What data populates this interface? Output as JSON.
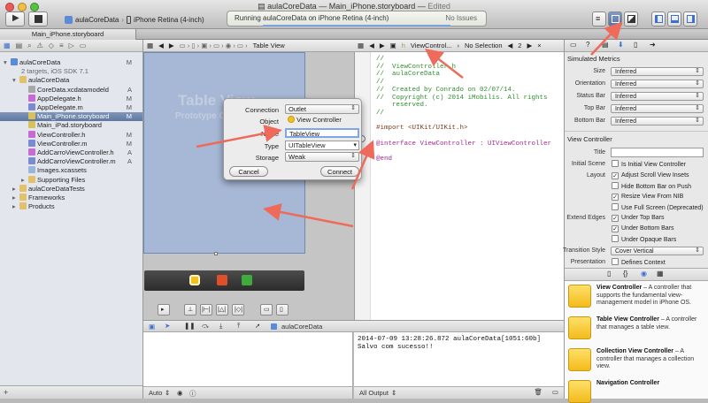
{
  "window": {
    "project_name": "aulaCoreData",
    "file_name": "Main_iPhone.storyboard",
    "edited_label": "Edited",
    "title_separator": "—"
  },
  "toolbar": {
    "scheme_project": "aulaCoreData",
    "scheme_device": "iPhone Retina (4-inch)",
    "status_text": "Running aulaCoreData on iPhone Retina (4-inch)",
    "issues_text": "No Issues"
  },
  "tab": {
    "label": "Main_iPhone.storyboard"
  },
  "navigator": {
    "items": [
      {
        "label": "aulaCoreData",
        "status": "M",
        "indent": 0,
        "kind": "project"
      },
      {
        "label": "2 targets, iOS SDK 7.1",
        "status": "",
        "indent": 1,
        "kind": "sub"
      },
      {
        "label": "aulaCoreData",
        "status": "",
        "indent": 1,
        "kind": "folder"
      },
      {
        "label": "CoreData.xcdatamodeld",
        "status": "A",
        "indent": 2,
        "kind": "model"
      },
      {
        "label": "AppDelegate.h",
        "status": "M",
        "indent": 2,
        "kind": "h"
      },
      {
        "label": "AppDelegate.m",
        "status": "M",
        "indent": 2,
        "kind": "m"
      },
      {
        "label": "Main_iPhone.storyboard",
        "status": "M",
        "indent": 2,
        "kind": "sb",
        "selected": true
      },
      {
        "label": "Main_iPad.storyboard",
        "status": "",
        "indent": 2,
        "kind": "sb"
      },
      {
        "label": "ViewController.h",
        "status": "M",
        "indent": 2,
        "kind": "h"
      },
      {
        "label": "ViewController.m",
        "status": "M",
        "indent": 2,
        "kind": "m"
      },
      {
        "label": "AddCarroViewController.h",
        "status": "A",
        "indent": 2,
        "kind": "h"
      },
      {
        "label": "AddCarroViewController.m",
        "status": "A",
        "indent": 2,
        "kind": "m"
      },
      {
        "label": "Images.xcassets",
        "status": "",
        "indent": 2,
        "kind": "assets"
      },
      {
        "label": "Supporting Files",
        "status": "",
        "indent": 2,
        "kind": "folder"
      },
      {
        "label": "aulaCoreDataTests",
        "status": "",
        "indent": 1,
        "kind": "folder"
      },
      {
        "label": "Frameworks",
        "status": "",
        "indent": 1,
        "kind": "folder"
      },
      {
        "label": "Products",
        "status": "",
        "indent": 1,
        "kind": "folder"
      }
    ]
  },
  "storyboard": {
    "jump_label": "Table View",
    "scene_title": "Table View",
    "scene_subtitle": "Prototype Content"
  },
  "assistant": {
    "jump_file": "ViewControl...",
    "jump_selection": "No Selection",
    "page_indicator": "2",
    "code_lines": [
      {
        "t": "//",
        "c": "cm"
      },
      {
        "t": "//  ViewController.h",
        "c": "cm"
      },
      {
        "t": "//  aulaCoreData",
        "c": "cm"
      },
      {
        "t": "//",
        "c": "cm"
      },
      {
        "t": "//  Created by Conrado on 02/07/14.",
        "c": "cm"
      },
      {
        "t": "//  Copyright (c) 2014 iMobilis. All rights",
        "c": "cm"
      },
      {
        "t": "    reserved.",
        "c": "cm"
      },
      {
        "t": "//",
        "c": "cm"
      },
      {
        "t": "",
        "c": ""
      },
      {
        "t": "#import <UIKit/UIKit.h>",
        "c": "pp"
      },
      {
        "t": "",
        "c": ""
      },
      {
        "t": "@interface ViewController : UIViewController",
        "c": "kw"
      },
      {
        "t": "",
        "c": ""
      },
      {
        "t": "@end",
        "c": "kw"
      }
    ]
  },
  "connection_popup": {
    "connection_label": "Connection",
    "connection_value": "Outlet",
    "object_label": "Object",
    "object_value": "View Controller",
    "name_label": "Name",
    "name_value": "TableView",
    "type_label": "Type",
    "type_value": "UITableView",
    "storage_label": "Storage",
    "storage_value": "Weak",
    "cancel_label": "Cancel",
    "connect_label": "Connect"
  },
  "debug": {
    "target_label": "aulaCoreData",
    "console_text": "2014-07-09 13:28:26.872 aulaCoreData[1051:60b] Salvo com sucesso!!",
    "auto_label": "Auto",
    "all_output_label": "All Output"
  },
  "inspector": {
    "simulated_title": "Simulated Metrics",
    "size_label": "Size",
    "size_value": "Inferred",
    "orientation_label": "Orientation",
    "orientation_value": "Inferred",
    "status_bar_label": "Status Bar",
    "status_bar_value": "Inferred",
    "top_bar_label": "Top Bar",
    "top_bar_value": "Inferred",
    "bottom_bar_label": "Bottom Bar",
    "bottom_bar_value": "Inferred",
    "vc_title": "View Controller",
    "title_label": "Title",
    "initial_scene_label": "Initial Scene",
    "is_initial_label": "Is Initial View Controller",
    "layout_label": "Layout",
    "adjust_scroll_label": "Adjust Scroll View Insets",
    "hide_bottom_label": "Hide Bottom Bar on Push",
    "resize_label": "Resize View From NIB",
    "use_full_label": "Use Full Screen (Deprecated)",
    "extend_edges_label": "Extend Edges",
    "under_top_label": "Under Top Bars",
    "under_bottom_label": "Under Bottom Bars",
    "under_opaque_label": "Under Opaque Bars",
    "transition_label": "Transition Style",
    "transition_value": "Cover Vertical",
    "presentation_label": "Presentation",
    "defines_context_label": "Defines Context"
  },
  "library": {
    "items": [
      {
        "title": "View Controller",
        "desc": " – A controller that supports the fundamental view-management model in iPhone OS."
      },
      {
        "title": "Table View Controller",
        "desc": " – A controller that manages a table view."
      },
      {
        "title": "Collection View Controller",
        "desc": " – A controller that manages a collection view."
      },
      {
        "title": "Navigation Controller",
        "desc": ""
      }
    ]
  }
}
